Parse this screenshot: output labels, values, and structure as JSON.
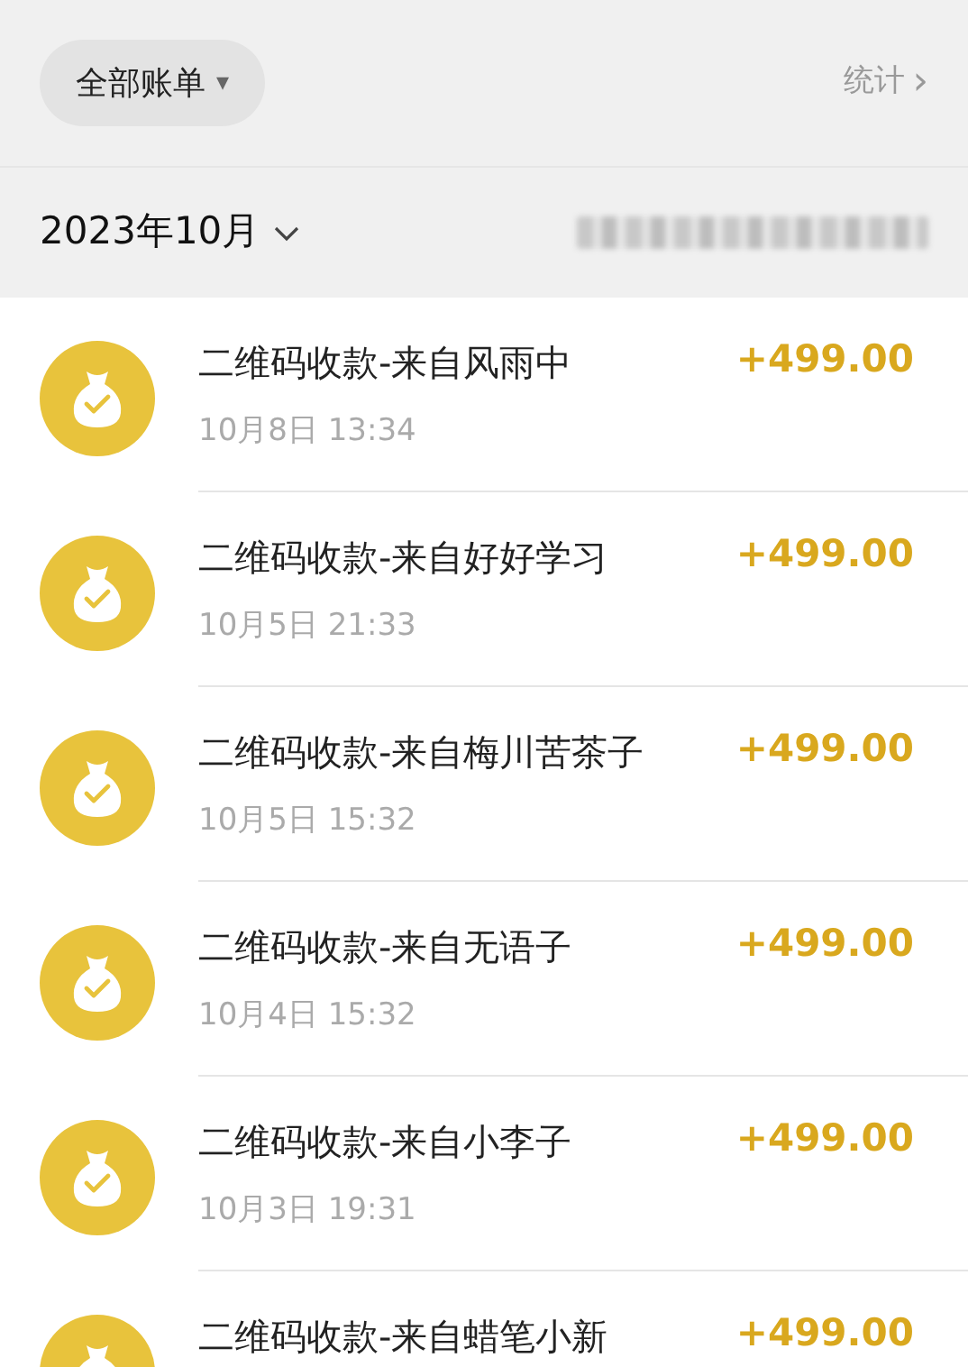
{
  "filter": {
    "label": "全部账单",
    "caret": "▾"
  },
  "stats_link": {
    "label": "统计",
    "chevron": "›"
  },
  "month": {
    "label": "2023年10月"
  },
  "transactions": [
    {
      "title": "二维码收款-来自风雨中",
      "time": "10月8日 13:34",
      "amount": "+499.00"
    },
    {
      "title": "二维码收款-来自好好学习",
      "time": "10月5日 21:33",
      "amount": "+499.00"
    },
    {
      "title": "二维码收款-来自梅川苦茶子",
      "time": "10月5日 15:32",
      "amount": "+499.00"
    },
    {
      "title": "二维码收款-来自无语子",
      "time": "10月4日 15:32",
      "amount": "+499.00"
    },
    {
      "title": "二维码收款-来自小李子",
      "time": "10月3日 19:31",
      "amount": "+499.00"
    },
    {
      "title": "二维码收款-来自蜡笔小新",
      "amount": "+499.00"
    }
  ]
}
